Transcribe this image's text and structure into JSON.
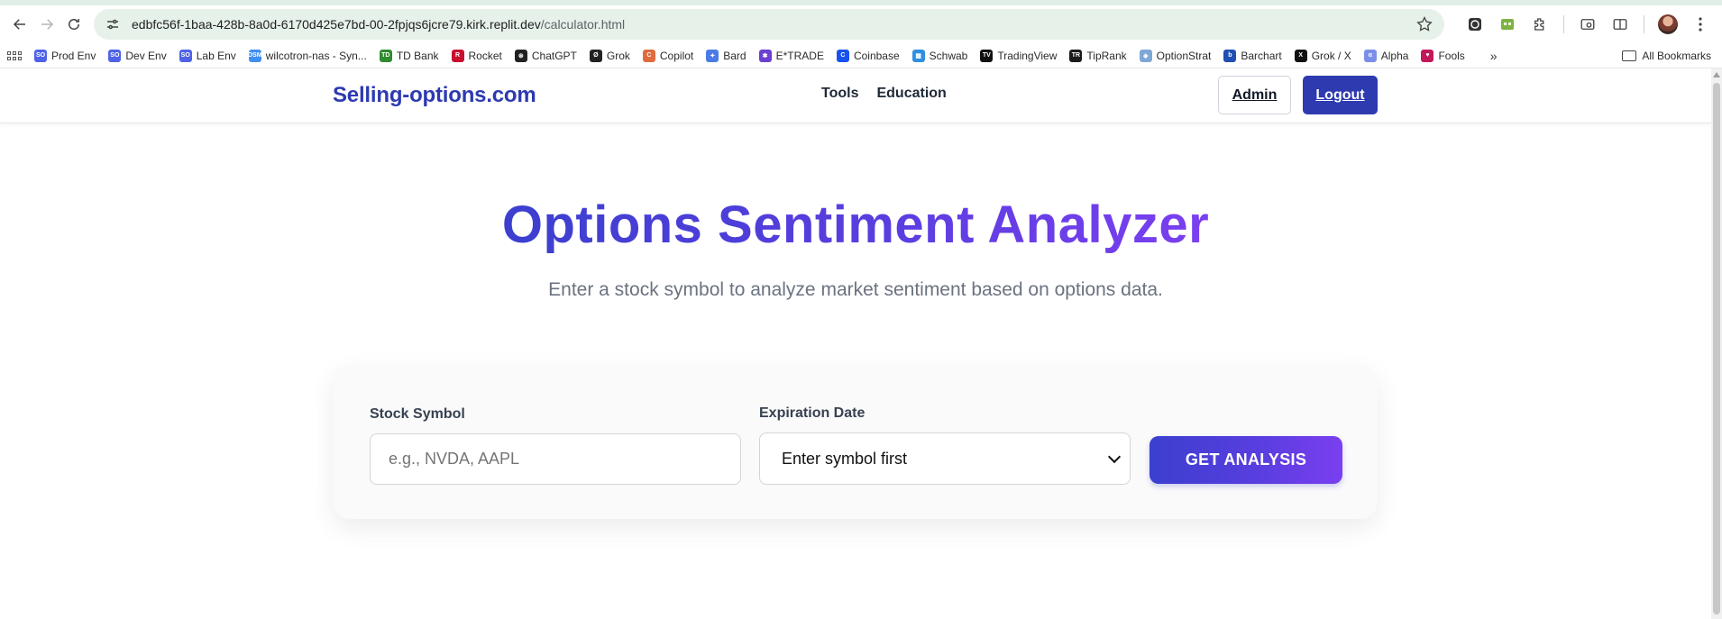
{
  "browser": {
    "url_host": "edbfc56f-1baa-428b-8a0d-6170d425e7bd-00-2fpjqs6jcre79.kirk.replit.dev",
    "url_path": "/calculator.html",
    "bookmarks": [
      {
        "label": "Prod Env",
        "icon": "SO",
        "color": "#4f62e8"
      },
      {
        "label": "Dev Env",
        "icon": "SO",
        "color": "#4f62e8"
      },
      {
        "label": "Lab Env",
        "icon": "SO",
        "color": "#4f62e8"
      },
      {
        "label": "wilcotron-nas - Syn...",
        "icon": "DSM",
        "color": "#3f8ef0"
      },
      {
        "label": "TD Bank",
        "icon": "TD",
        "color": "#2e8b2e"
      },
      {
        "label": "Rocket",
        "icon": "R",
        "color": "#c8102e"
      },
      {
        "label": "ChatGPT",
        "icon": "⊛",
        "color": "#222222"
      },
      {
        "label": "Grok",
        "icon": "Ø",
        "color": "#222222"
      },
      {
        "label": "Copilot",
        "icon": "C",
        "color": "#e06b3f"
      },
      {
        "label": "Bard",
        "icon": "✦",
        "color": "#4b7be5"
      },
      {
        "label": "E*TRADE",
        "icon": "✱",
        "color": "#6b3fd0"
      },
      {
        "label": "Coinbase",
        "icon": "C",
        "color": "#1652f0"
      },
      {
        "label": "Schwab",
        "icon": "▦",
        "color": "#2f8fe0"
      },
      {
        "label": "TradingView",
        "icon": "TV",
        "color": "#111111"
      },
      {
        "label": "TipRank",
        "icon": "TR",
        "color": "#1b1b1b"
      },
      {
        "label": "OptionStrat",
        "icon": "◈",
        "color": "#7fa7d6"
      },
      {
        "label": "Barchart",
        "icon": "b",
        "color": "#1f4fb0"
      },
      {
        "label": "Grok / X",
        "icon": "X",
        "color": "#111111"
      },
      {
        "label": "Alpha",
        "icon": "α",
        "color": "#7c8ee8"
      },
      {
        "label": "Fools",
        "icon": "♥",
        "color": "#c2185b"
      }
    ],
    "bookmarks_more": "»",
    "all_bookmarks": "All Bookmarks"
  },
  "header": {
    "brand": "Selling-options.com",
    "nav": [
      "Tools",
      "Education"
    ],
    "admin_label": "Admin",
    "logout_label": "Logout"
  },
  "hero": {
    "title": "Options Sentiment Analyzer",
    "subtitle": "Enter a stock symbol to analyze market sentiment based on options data."
  },
  "form": {
    "symbol_label": "Stock Symbol",
    "symbol_placeholder": "e.g., NVDA, AAPL",
    "symbol_value": "",
    "expiration_label": "Expiration Date",
    "expiration_selected": "Enter symbol first",
    "submit_label": "GET ANALYSIS"
  }
}
